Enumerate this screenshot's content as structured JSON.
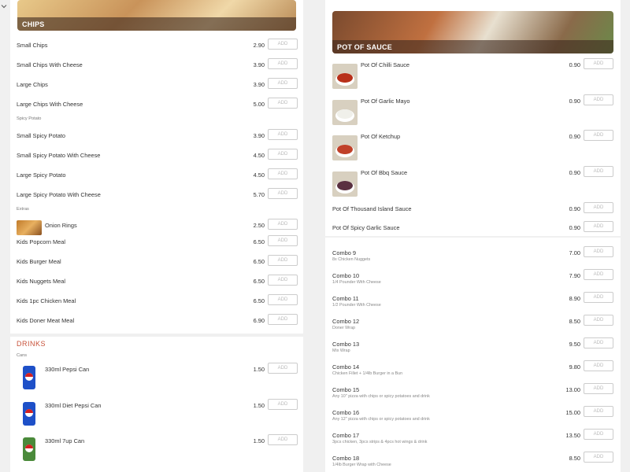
{
  "left": {
    "chips_banner": "CHIPS",
    "spicy_section": "Spicy Potato",
    "extras_section": "Extras",
    "items": [
      {
        "name": "Small Chips",
        "price": "2.90"
      },
      {
        "name": "Small Chips With Cheese",
        "price": "3.90"
      },
      {
        "name": "Large Chips",
        "price": "3.90"
      },
      {
        "name": "Large Chips With Cheese",
        "price": "5.00"
      },
      {
        "name": "Small Spicy Potato",
        "price": "3.90"
      },
      {
        "name": "Small Spicy Potato With Cheese",
        "price": "4.50"
      },
      {
        "name": "Large Spicy Potato",
        "price": "4.50"
      },
      {
        "name": "Large Spicy Potato With Cheese",
        "price": "5.70"
      },
      {
        "name": "Onion Rings",
        "price": "2.50"
      },
      {
        "name": "Kids Popcorn Meal",
        "price": "6.50"
      },
      {
        "name": "Kids Burger Meal",
        "price": "6.50"
      },
      {
        "name": "Kids Nuggets Meal",
        "price": "6.50"
      },
      {
        "name": "Kids 1pc Chicken Meal",
        "price": "6.50"
      },
      {
        "name": "Kids Doner Meat Meal",
        "price": "6.90"
      }
    ],
    "drinks_title": "DRINKS",
    "cans_section": "Cans",
    "drinks": [
      {
        "name": "330ml Pepsi Can",
        "price": "1.50"
      },
      {
        "name": "330ml Diet Pepsi Can",
        "price": "1.50"
      },
      {
        "name": "330ml 7up Can",
        "price": "1.50"
      }
    ]
  },
  "right": {
    "sauce_banner": "POT OF SAUCE",
    "sauces": [
      {
        "name": "Pot Of Chilli Sauce",
        "price": "0.90"
      },
      {
        "name": "Pot Of Garlic Mayo",
        "price": "0.90"
      },
      {
        "name": "Pot Of Ketchup",
        "price": "0.90"
      },
      {
        "name": "Pot Of Bbq Sauce",
        "price": "0.90"
      },
      {
        "name": "Pot Of Thousand Island Sauce",
        "price": "0.90"
      },
      {
        "name": "Pot Of Spicy Garlic Sauce",
        "price": "0.90"
      }
    ],
    "combos": [
      {
        "name": "Combo 9",
        "desc": "8x Chicken Nuggets",
        "price": "7.00"
      },
      {
        "name": "Combo 10",
        "desc": "1/4 Pounder With Cheese",
        "price": "7.90"
      },
      {
        "name": "Combo 11",
        "desc": "1/2 Pounder With Cheese",
        "price": "8.90"
      },
      {
        "name": "Combo 12",
        "desc": "Doner Wrap",
        "price": "8.50"
      },
      {
        "name": "Combo 13",
        "desc": "Mix Wrap",
        "price": "9.50"
      },
      {
        "name": "Combo 14",
        "desc": "Chicken Fillet + 1/4lb Burger in a Bun",
        "price": "9.80"
      },
      {
        "name": "Combo 15",
        "desc": "Any 10\" pizza with chips or spicy potatoes and drink",
        "price": "13.00"
      },
      {
        "name": "Combo 16",
        "desc": "Any 12\" pizza with chips or spicy potatoes and drink",
        "price": "15.00"
      },
      {
        "name": "Combo 17",
        "desc": "3pcs chicken, 3pcs strips & 4pcs hot wings & drink",
        "price": "13.50"
      },
      {
        "name": "Combo 18",
        "desc": "1/4lb Burger Wrap with Cheese",
        "price": "8.50"
      }
    ]
  },
  "add_label": "ADD",
  "icons": {
    "chevron": "chevron-down-icon"
  }
}
